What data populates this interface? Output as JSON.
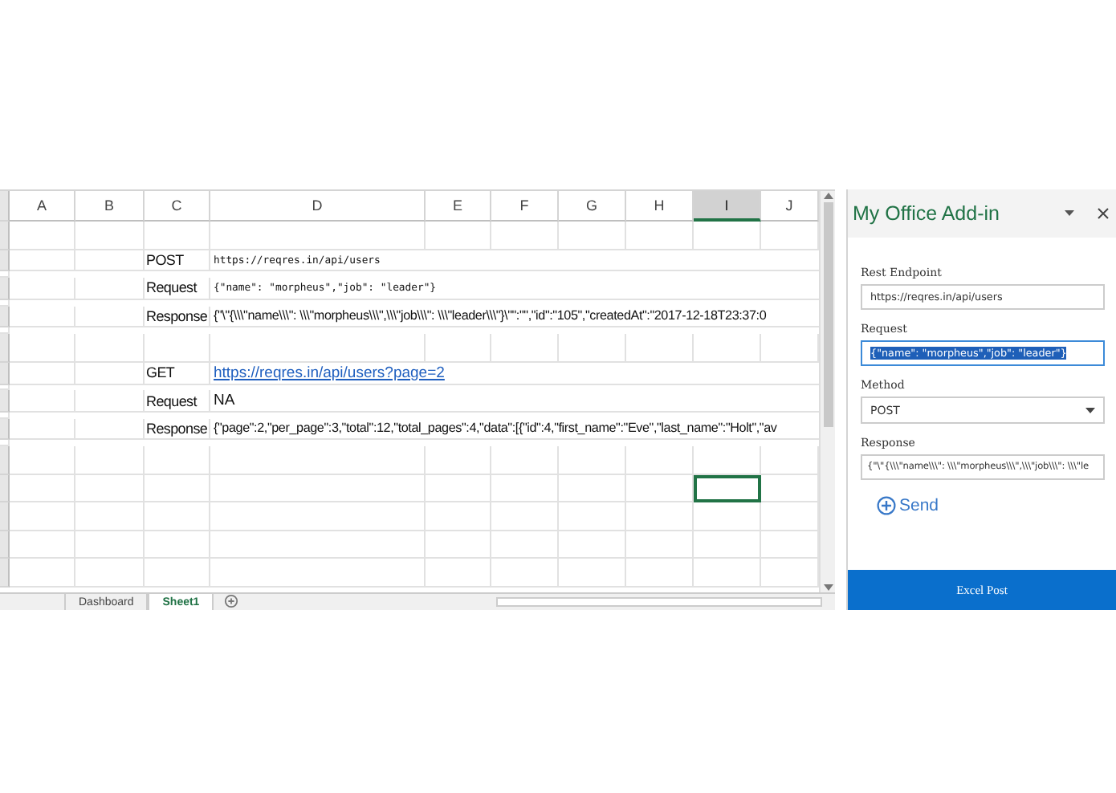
{
  "spreadsheet": {
    "columns": [
      {
        "label": "A",
        "selected": false
      },
      {
        "label": "B",
        "selected": false
      },
      {
        "label": "C",
        "selected": false
      },
      {
        "label": "D",
        "selected": false
      },
      {
        "label": "E",
        "selected": false
      },
      {
        "label": "F",
        "selected": false
      },
      {
        "label": "G",
        "selected": false
      },
      {
        "label": "H",
        "selected": false
      },
      {
        "label": "I",
        "selected": true
      },
      {
        "label": "J",
        "selected": false
      }
    ],
    "rows": [
      {
        "selected": false
      },
      {
        "label": "POST",
        "value": "https://reqres.in/api/users",
        "kind": "mono",
        "selected": false
      },
      {
        "label": "Request",
        "value": "{\"name\": \"morpheus\",\"job\": \"leader\"}",
        "kind": "mono",
        "selected": false
      },
      {
        "label": "Response",
        "value": "{\"\\\"{\\\\\\\"name\\\\\\\": \\\\\\\"morpheus\\\\\\\",\\\\\\\"job\\\\\\\": \\\\\\\"leader\\\\\\\"}\\\"\":\"\",\"id\":\"105\",\"createdAt\":\"2017-12-18T23:37:0",
        "kind": "text",
        "selected": false
      },
      {
        "selected": false
      },
      {
        "label": "GET",
        "value": "https://reqres.in/api/users?page=2",
        "kind": "link",
        "selected": false
      },
      {
        "label": "Request",
        "value": "NA",
        "kind": "text",
        "selected": false
      },
      {
        "label": "Response",
        "value": "{\"page\":2,\"per_page\":3,\"total\":12,\"total_pages\":4,\"data\":[{\"id\":4,\"first_name\":\"Eve\",\"last_name\":\"Holt\",\"av",
        "kind": "text",
        "selected": false
      },
      {
        "selected": false
      },
      {
        "selected": true
      },
      {
        "selected": false
      },
      {
        "selected": false
      },
      {
        "selected": false
      }
    ],
    "sheet_tabs": [
      {
        "label": "Dashboard",
        "selected": false
      },
      {
        "label": "Sheet1",
        "selected": true
      }
    ]
  },
  "addin": {
    "title": "My Office Add-in",
    "fields": [
      {
        "label": "Rest Endpoint",
        "kind": "text",
        "value": "https://reqres.in/api/users",
        "focused": false
      },
      {
        "label": "Request",
        "kind": "text",
        "value": "{\"name\": \"morpheus\",\"job\": \"leader\"}",
        "focused": true
      },
      {
        "label": "Method",
        "kind": "select",
        "value": "POST",
        "focused": false
      },
      {
        "label": "Response",
        "kind": "text",
        "value": "{\"\\\"{\\\\\\\"name\\\\\\\": \\\\\\\"morpheus\\\\\\\",\\\\\\\"job\\\\\\\": \\\\\\\"le",
        "focused": false
      }
    ],
    "send_button": "Send",
    "footer_button": "Excel Post"
  }
}
